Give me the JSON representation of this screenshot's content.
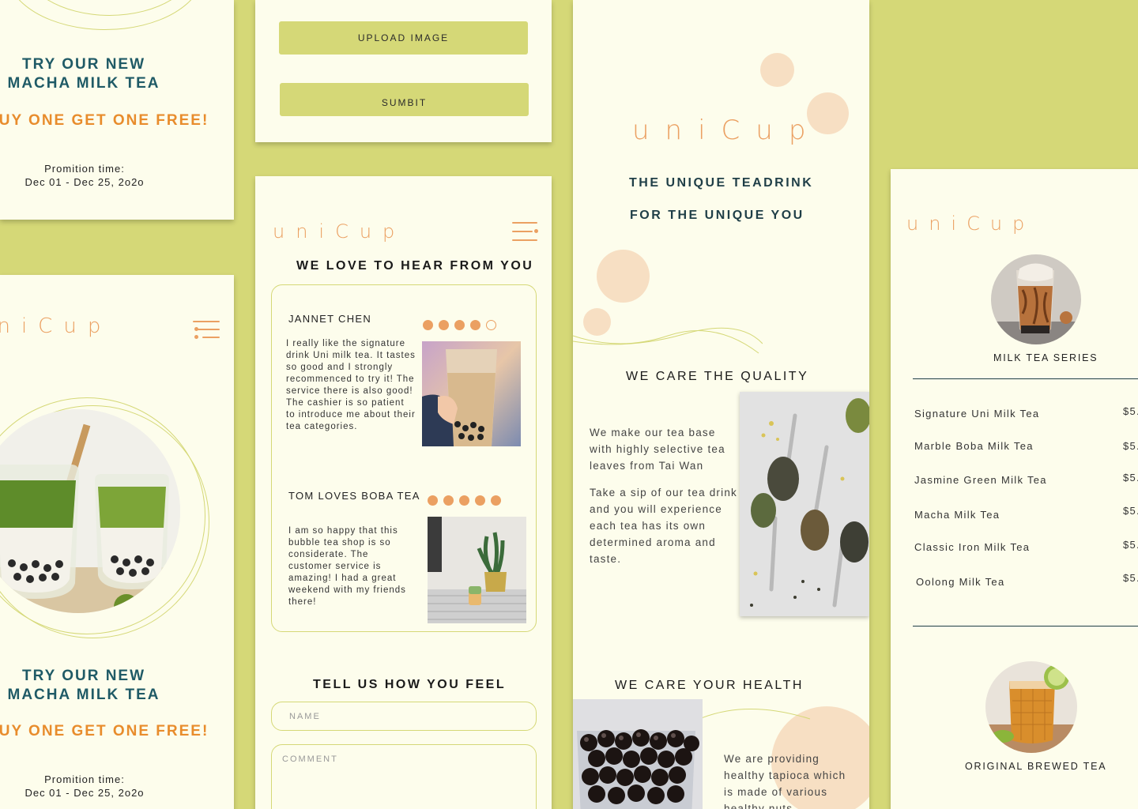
{
  "promo_card_top": {
    "title_line1": "TRY OUR NEW",
    "title_line2": "MACHA MILK TEA",
    "offer": "BUY ONE GET ONE FREE!",
    "time_label": "Promition time:",
    "time_range": "Dec 01 - Dec 25, 2o2o"
  },
  "promo_card_bottom": {
    "logo": "uniCup",
    "title_line1": "TRY OUR NEW",
    "title_line2": "MACHA MILK TEA",
    "offer": "BUY ONE GET ONE FREE!",
    "time_label": "Promition time:",
    "time_range": "Dec 01 - Dec 25, 2o2o"
  },
  "upload_card": {
    "upload_label": "UPLOAD IMAGE",
    "submit_label": "SUMBIT"
  },
  "review_card": {
    "logo": "uniCup",
    "heading": "WE LOVE TO HEAR FROM YOU",
    "reviews": [
      {
        "name": "JANNET CHEN",
        "rating": 4,
        "max_rating": 5,
        "text": "I really like the signature drink Uni milk tea. It tastes so good and I strongly recommenced to try it! The service there is also good! The cashier is so patient to introduce me about their tea categories."
      },
      {
        "name": "TOM LOVES BOBA TEA",
        "rating": 5,
        "max_rating": 5,
        "text": "I am so happy that this bubble tea shop is so considerate. The customer service is amazing! I had a great weekend with my friends there!"
      }
    ],
    "form_heading": "TELL US HOW YOU FEEL",
    "name_placeholder": "NAME",
    "comment_placeholder": "COMMENT"
  },
  "about_card": {
    "logo": "uniCup",
    "tagline_line1": "THE UNIQUE TEADRINK",
    "tagline_line2": "FOR THE UNIQUE YOU",
    "quality_heading": "WE CARE THE QUALITY",
    "quality_p1": "We make our tea base with highly selective tea leaves from Tai Wan",
    "quality_p2": "Take a sip of our tea drink and you will experience each tea has its own determined aroma and taste.",
    "health_heading": "WE CARE YOUR HEALTH",
    "health_p1": "We are providing healthy tapioca which is made of various healthy nuts"
  },
  "menu_card": {
    "logo": "uniCup",
    "series_title": "MILK TEA SERIES",
    "items": [
      {
        "name": "Signature Uni Milk Tea",
        "price": "$5."
      },
      {
        "name": "Marble Boba Milk Tea",
        "price": "$5."
      },
      {
        "name": "Jasmine Green Milk Tea",
        "price": "$5."
      },
      {
        "name": "Macha Milk Tea",
        "price": "$5."
      },
      {
        "name": "Classic Iron Milk Tea",
        "price": "$5."
      },
      {
        "name": "Oolong Milk Tea",
        "price": "$5."
      }
    ],
    "brewed_title": "ORIGINAL BREWED TEA"
  },
  "colors": {
    "background": "#d5d877",
    "card": "#fdfdec",
    "accent_orange": "#eba062",
    "teal": "#1f5a66",
    "peach": "#f7dfc3"
  }
}
